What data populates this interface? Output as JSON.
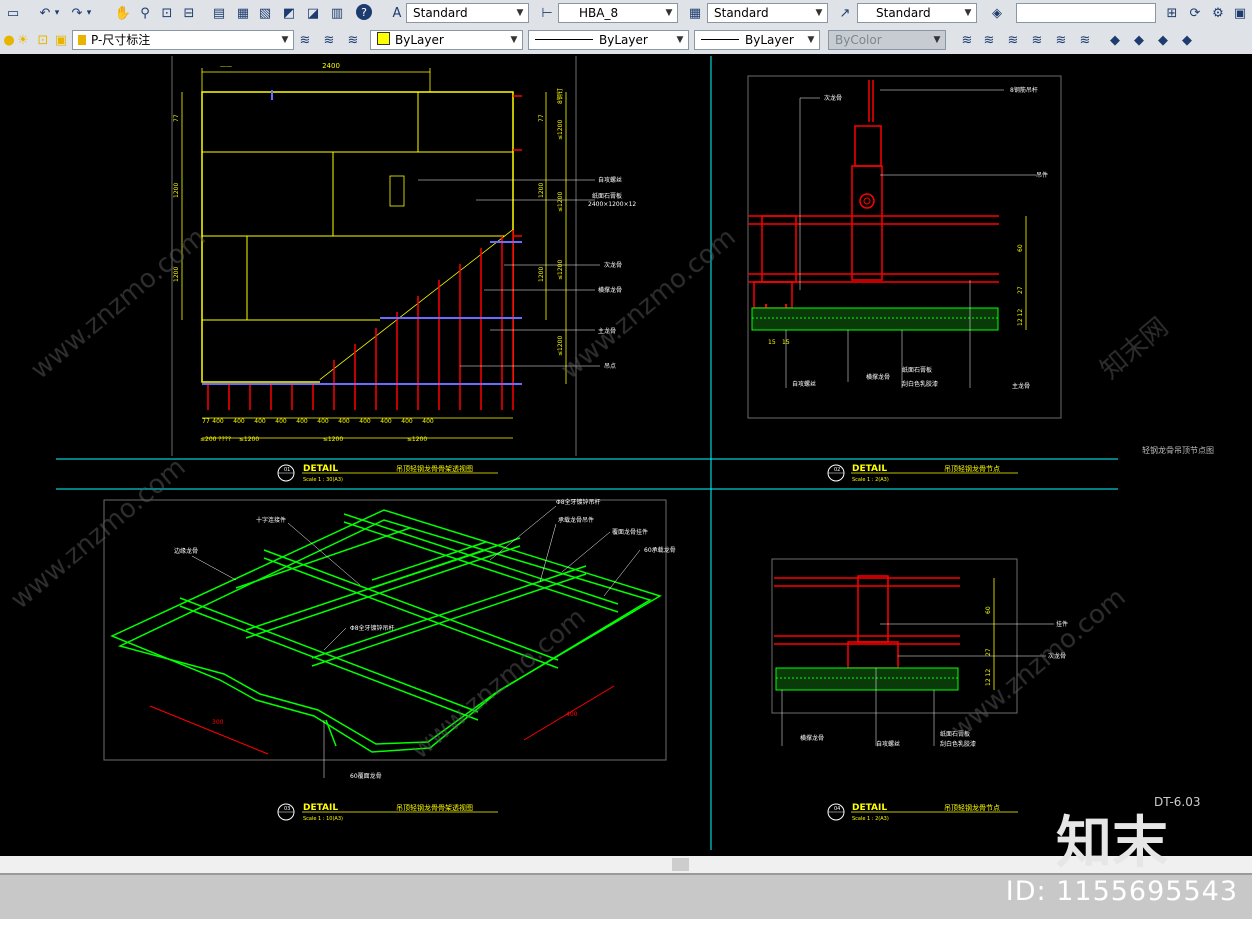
{
  "toolbar1": {
    "text_style": "Standard",
    "dim_style": "HBA_8",
    "table_style": "Standard",
    "multileader_style": "Standard",
    "search_value": ""
  },
  "toolbar2": {
    "layer": "P-尺寸标注",
    "color": "ByLayer",
    "linetype": "ByLayer",
    "lineweight": "ByLayer",
    "plot_style": "ByColor"
  },
  "drawing": {
    "panel_a": {
      "dim_top": "2400",
      "dim_left": [
        "77",
        "1200",
        "1200"
      ],
      "dim_right_1": [
        "77",
        "1200",
        "1200"
      ],
      "dim_right_2": [
        "8钢钉",
        "≤1200",
        "≤1200",
        "≤1200",
        "≤1200"
      ],
      "dim_bottom_spacings": [
        "77",
        "400",
        "400",
        "400",
        "400",
        "400",
        "400",
        "400",
        "400",
        "400",
        "400",
        "400"
      ],
      "dim_bottom_2": [
        "≤200 ????",
        "≤1200",
        "≤1200",
        "≤1200"
      ],
      "labels": [
        "自攻螺丝",
        "纸面石膏板\n2400×1200×12",
        "次龙骨",
        "横撑龙骨",
        "主龙骨",
        "吊点"
      ]
    },
    "panel_b": {
      "labels": [
        "8钢筋吊杆",
        "次龙骨",
        "吊件",
        "自攻螺丝",
        "横撑龙骨",
        "纸面石膏板",
        "刮白色乳胶漆",
        "主龙骨"
      ],
      "dims": [
        "60",
        "27",
        "12 12",
        "15",
        "15"
      ]
    },
    "panel_c": {
      "labels": [
        "十字连接件",
        "边缘龙骨",
        "Φ8全牙镀锌吊杆",
        "承载龙骨吊件",
        "覆面龙骨挂件",
        "60承载龙骨",
        "Φ8全牙镀锌吊杆",
        "60覆面龙骨"
      ],
      "dims": [
        "300",
        "400"
      ]
    },
    "panel_d": {
      "labels": [
        "挂件",
        "次龙骨",
        "横撑龙骨",
        "自攻螺丝",
        "纸面石膏板",
        "刮白色乳胶漆"
      ],
      "dims": [
        "60",
        "27",
        "12 12"
      ]
    },
    "titles": {
      "p1": {
        "num": "01",
        "detail": "DETAIL",
        "scale": "Scale 1 : 30(A3)",
        "name": "吊顶轻钢龙骨骨架透视图"
      },
      "p2": {
        "num": "02",
        "detail": "DETAIL",
        "scale": "Scale 1 : 2(A3)",
        "name": "吊顶轻钢龙骨节点"
      },
      "p3": {
        "num": "03",
        "detail": "DETAIL",
        "scale": "Scale 1 : 10(A3)",
        "name": "吊顶轻钢龙骨骨架透视图"
      },
      "p4": {
        "num": "04",
        "detail": "DETAIL",
        "scale": "Scale 1 : 2(A3)",
        "name": "吊顶轻钢龙骨节点"
      }
    },
    "side_note": "轻钢龙骨吊顶节点图",
    "sheet_no": "DT-6.03"
  },
  "watermark": {
    "logo": "知末",
    "id": "ID: 1155695543",
    "site": "www.znzmo.com",
    "cn": "知末网"
  },
  "colors": {
    "toolbar": "#dfe3e8",
    "canvas": "#000000",
    "yellow": "#ffff00",
    "red": "#ff0000",
    "green": "#00ff00",
    "cyan": "#00ffff",
    "white": "#ffffff"
  },
  "icons": {
    "toolbar1": [
      "new-icon",
      "undo-icon",
      "redo-icon",
      "pan-icon",
      "zoom-realtime-icon",
      "zoom-window-icon",
      "zoom-previous-icon",
      "properties-icon",
      "design-center-icon",
      "tool-palettes-icon",
      "sheet-set-icon",
      "markup-icon",
      "calculator-icon",
      "help-icon",
      "text-style-icon",
      "dim-style-icon",
      "table-style-icon",
      "mleader-style-icon",
      "layer-states-icon",
      "search-button-icons"
    ],
    "toolbar2": [
      "bulb-icon",
      "sun-icon",
      "freeze-icon",
      "lock-icon",
      "layer-previous-icon",
      "layer-icons"
    ]
  }
}
